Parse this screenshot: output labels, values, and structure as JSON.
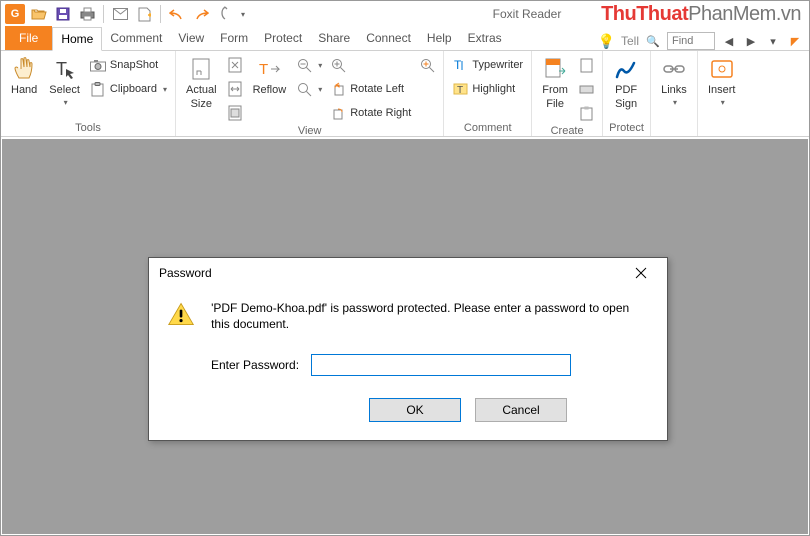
{
  "app_title": "Foxit Reader",
  "watermark": {
    "a": "ThuThuat",
    "b": "PhanMem",
    "c": ".vn"
  },
  "tabs": {
    "file": "File",
    "items": [
      "Home",
      "Comment",
      "View",
      "Form",
      "Protect",
      "Share",
      "Connect",
      "Help",
      "Extras"
    ],
    "active": "Home",
    "tell": "Tell",
    "find_placeholder": "Find"
  },
  "ribbon": {
    "tools": {
      "label": "Tools",
      "hand": "Hand",
      "select": "Select",
      "snapshot": "SnapShot",
      "clipboard": "Clipboard"
    },
    "view": {
      "label": "View",
      "actual_size_1": "Actual",
      "actual_size_2": "Size",
      "reflow": "Reflow",
      "rotate_left": "Rotate Left",
      "rotate_right": "Rotate Right"
    },
    "comment": {
      "label": "Comment",
      "typewriter": "Typewriter",
      "highlight": "Highlight"
    },
    "create": {
      "label": "Create",
      "from_file_1": "From",
      "from_file_2": "File"
    },
    "protect": {
      "label": "Protect",
      "pdf_sign_1": "PDF",
      "pdf_sign_2": "Sign"
    },
    "links": {
      "label": "Links"
    },
    "insert": {
      "label": "Insert"
    }
  },
  "dialog": {
    "title": "Password",
    "message": "'PDF Demo-Khoa.pdf' is password protected. Please enter a password to open this document.",
    "label": "Enter Password:",
    "ok": "OK",
    "cancel": "Cancel"
  }
}
